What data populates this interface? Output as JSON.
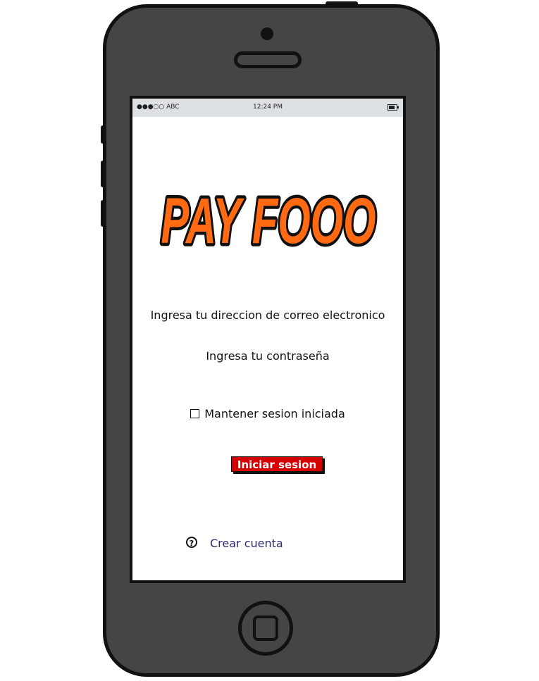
{
  "status_bar": {
    "carrier": "●●●○○ ABC",
    "time": "12:24 PM"
  },
  "logo": {
    "text": "PAY FOOO",
    "fill_color": "#ff6a13",
    "outline_color": "#111111"
  },
  "form": {
    "email_label": "Ingresa tu direccion de correo electronico",
    "password_label": "Ingresa tu contraseña",
    "remember_label": "Mantener sesion iniciada",
    "remember_checked": false,
    "login_button": "Iniciar sesion",
    "login_button_color": "#d50000"
  },
  "footer": {
    "help_icon": "?",
    "create_account": "Crear cuenta"
  }
}
